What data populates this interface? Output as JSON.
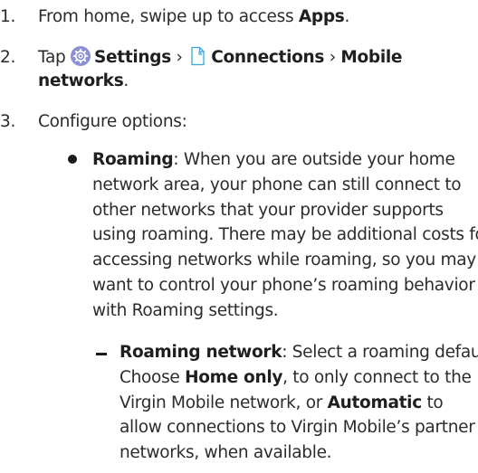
{
  "steps": [
    {
      "number": "1.",
      "prefix": "From home, swipe up to access ",
      "apps": "Apps",
      "suffix": "."
    },
    {
      "number": "2.",
      "tap": "Tap ",
      "settings": "Settings",
      "sep1": " › ",
      "connections": "Connections",
      "sep2": " › ",
      "mobile": "Mobile",
      "networks": "networks",
      "end": "."
    },
    {
      "number": "3.",
      "text": "Configure options:"
    }
  ],
  "roaming": {
    "term": "Roaming",
    "lines": [
      ": When you are outside your home",
      "network area, your phone can still connect to",
      "other networks that your provider supports",
      "using roaming. There may be additional costs for",
      "accessing networks while roaming, so you may",
      "want to control your phone’s roaming behavior",
      "with Roaming settings."
    ]
  },
  "roaming_network": {
    "term": "Roaming network",
    "line1": ": Select a roaming default.",
    "choose": "Choose ",
    "home_only": "Home only",
    "line2_end": ", to only connect to the",
    "line3_start": "Virgin Mobile network, or ",
    "automatic": "Automatic",
    "line3_end": " to",
    "line4": "allow connections to Virgin Mobile’s partner",
    "line5": "networks, when available."
  },
  "colors": {
    "settings_icon": "#8a8fd6",
    "connections_icon": "#39a9d9"
  },
  "icons": [
    "settings-gear-icon",
    "connections-icon"
  ]
}
